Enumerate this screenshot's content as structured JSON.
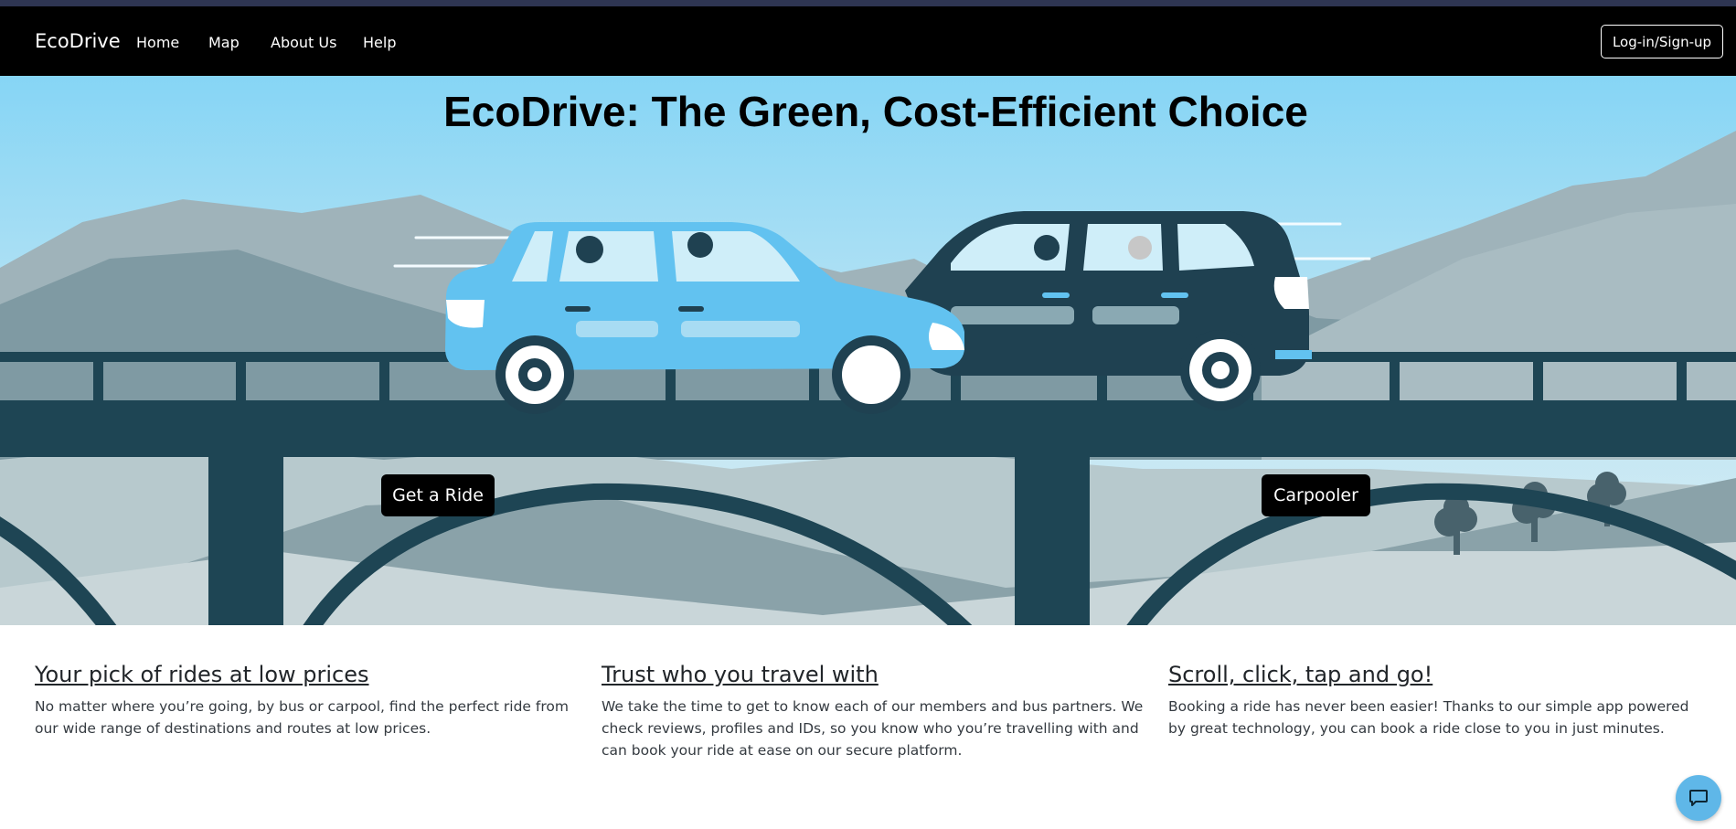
{
  "app": {
    "brand": "EcoDrive"
  },
  "nav": {
    "items": [
      {
        "label": "Home"
      },
      {
        "label": "Map"
      },
      {
        "label": "About Us"
      },
      {
        "label": "Help"
      }
    ],
    "login_label": "Log-in/Sign-up"
  },
  "hero": {
    "title": "EcoDrive: The Green, Cost-Efficient Choice",
    "primary_button": "Get a Ride",
    "secondary_button": "Carpooler"
  },
  "features": [
    {
      "title": "Your pick of rides at low prices",
      "body": "No matter where you’re going, by bus or carpool, find the perfect ride from our wide range of destinations and routes at low prices."
    },
    {
      "title": "Trust who you travel with",
      "body": "We take the time to get to know each of our members and bus partners. We check reviews, profiles and IDs, so you know who you’re travelling with and can book your ride at ease on our secure platform."
    },
    {
      "title": "Scroll, click, tap and go!",
      "body": "Booking a ride has never been easier! Thanks to our simple app powered by great technology, you can book a ride close to you in just minutes."
    }
  ],
  "chat": {
    "icon": "chat-bubble-icon"
  },
  "colors": {
    "navbar": "#000000",
    "sky": "#8fd6f3",
    "bridge": "#1e4554",
    "light_car": "#62c2f0",
    "dark_car": "#1f4151",
    "chat_button": "#5fb7e8"
  }
}
